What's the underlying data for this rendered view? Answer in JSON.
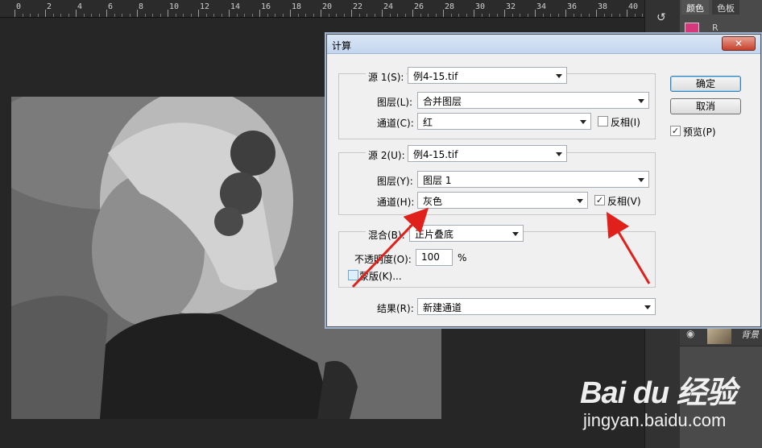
{
  "ruler": {
    "labels": [
      "0",
      "2",
      "4",
      "6",
      "8",
      "10",
      "12",
      "14",
      "16",
      "18",
      "20",
      "22",
      "24",
      "26",
      "28",
      "30",
      "32",
      "34",
      "36",
      "38",
      "40"
    ]
  },
  "panel": {
    "tabs": [
      "颜色",
      "色板"
    ],
    "channel_letter": "R",
    "layer_name": "背景"
  },
  "dialog": {
    "title": "计算",
    "close_glyph": "✕",
    "source1": {
      "label": "源 1(S):",
      "file": "例4-15.tif",
      "layer_label": "图层(L):",
      "layer": "合并图层",
      "channel_label": "通道(C):",
      "channel": "红",
      "invert_label": "反相(I)",
      "invert_checked": false
    },
    "source2": {
      "label": "源 2(U):",
      "file": "例4-15.tif",
      "layer_label": "图层(Y):",
      "layer": "图层 1",
      "channel_label": "通道(H):",
      "channel": "灰色",
      "invert_label": "反相(V)",
      "invert_checked": true
    },
    "blend": {
      "label": "混合(B):",
      "mode": "正片叠底",
      "opacity_label": "不透明度(O):",
      "opacity": "100",
      "percent": "%",
      "mask_label": "蒙版(K)..."
    },
    "result": {
      "label": "结果(R):",
      "value": "新建通道"
    },
    "buttons": {
      "ok": "确定",
      "cancel": "取消"
    },
    "preview": {
      "label": "预览(P)",
      "checked": true
    }
  },
  "watermark": {
    "brand": "Bai du 经验",
    "url": "jingyan.baidu.com"
  },
  "accent": "#e0201b",
  "icons": {
    "check": "✓",
    "eye": "👁"
  }
}
